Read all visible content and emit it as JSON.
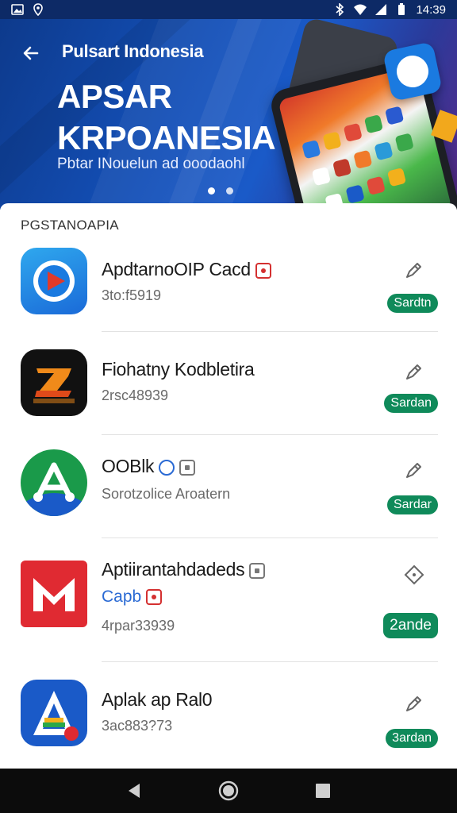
{
  "status_bar": {
    "time": "14:39"
  },
  "hero": {
    "title": "Pulsart Indonesia",
    "heading_line1": "APSAR",
    "heading_line2": "KRPOANESIA",
    "subtitle": "Pbtar INouelun ad ooodaohl"
  },
  "section_label": "PGSTANOAPIA",
  "apps": [
    {
      "name": "ApdtarnoOIP Cacd",
      "meta": "3to:f5919",
      "action": "Sardtn"
    },
    {
      "name": "Fiohatny Kodbletira",
      "meta": "2rsc48939",
      "action": "Sardan"
    },
    {
      "name": "OOBlk",
      "meta": "Sorotzolice Aroatern",
      "action": "Sardar"
    },
    {
      "name": "Aptiirantahdadeds",
      "link": "Capb",
      "meta": "4rpar33939",
      "action": "2ande"
    },
    {
      "name": "Aplak ap Ral0",
      "meta": "3ac883?73",
      "action": "3ardan"
    }
  ],
  "icons": {
    "status_left": [
      "gallery-icon",
      "location-icon"
    ],
    "status_right": [
      "bluetooth-icon",
      "wifi-icon",
      "signal-icon",
      "battery-icon"
    ],
    "nav": [
      "back-triangle-icon",
      "home-circle-icon",
      "recents-square-icon"
    ]
  },
  "colors": {
    "hero_blue": "#1450b8",
    "action_green": "#0f8a5a",
    "status_bar": "#0d2a66",
    "nav_bar": "#0c0c0c"
  }
}
